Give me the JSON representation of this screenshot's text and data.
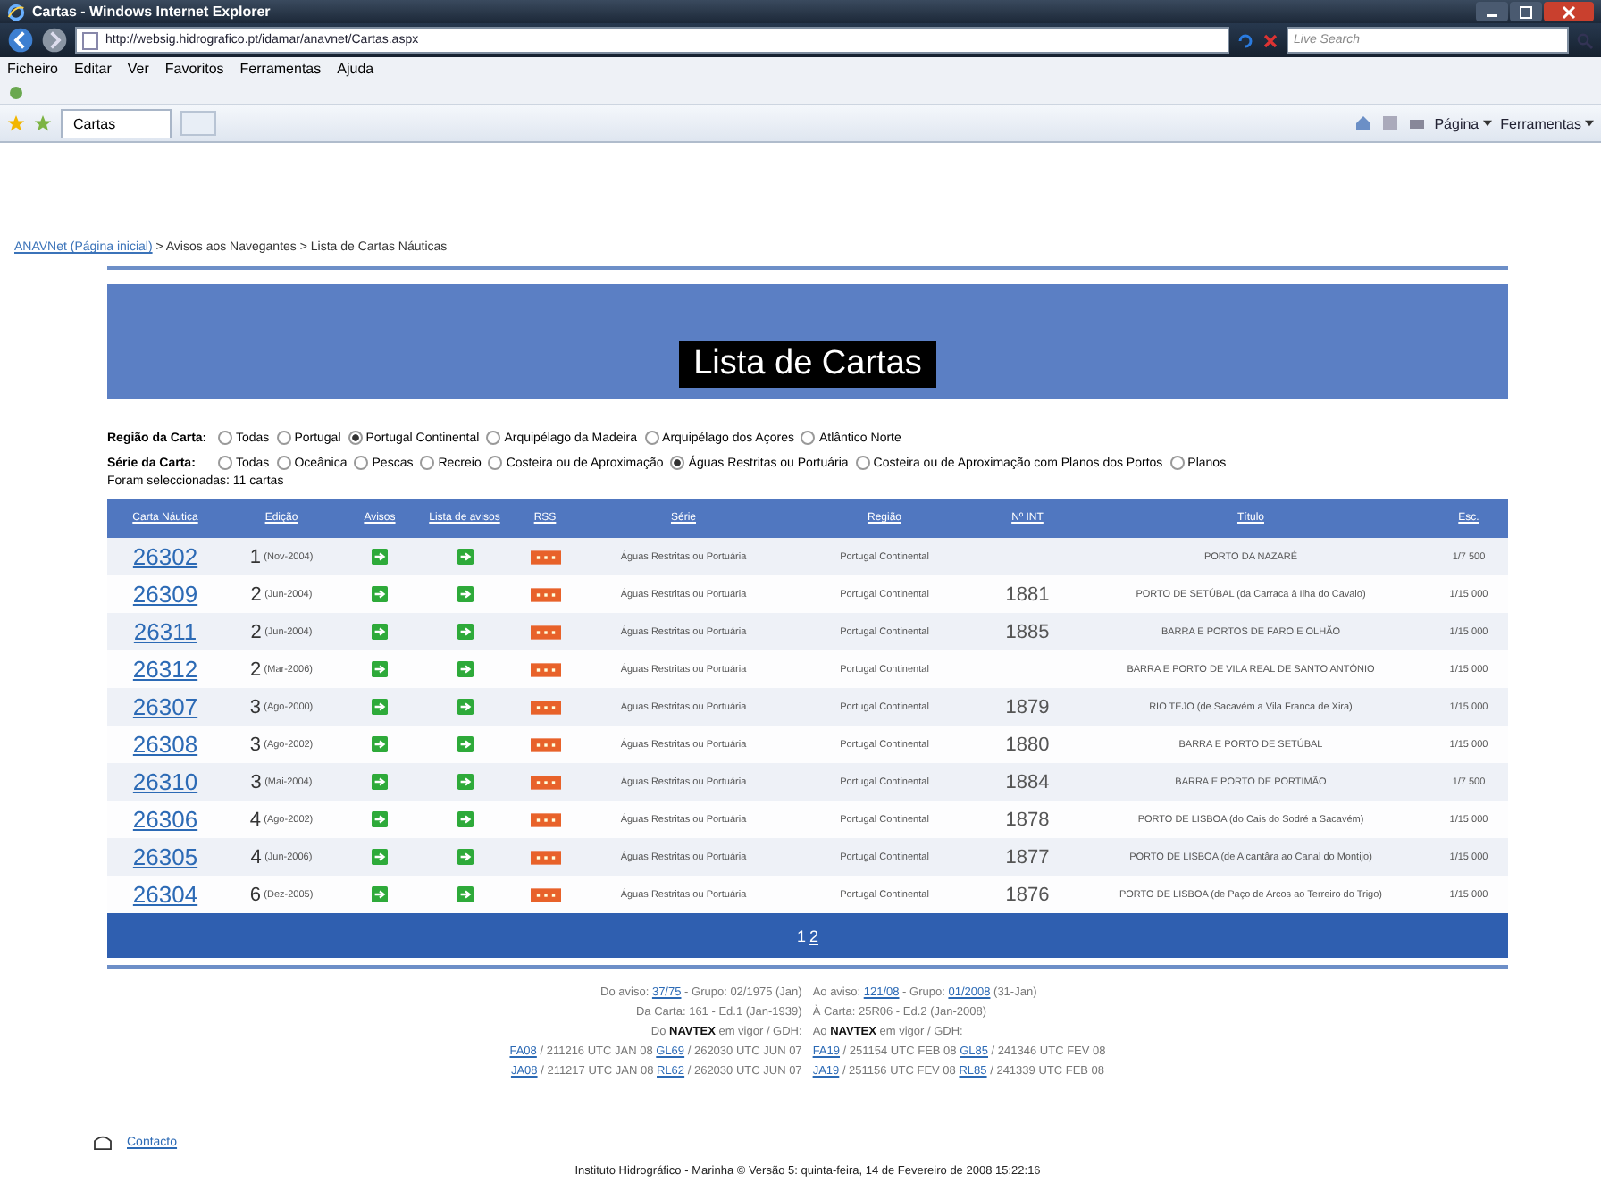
{
  "window": {
    "title": "Cartas - Windows Internet Explorer"
  },
  "address": {
    "url": "http://websig.hidrografico.pt/idamar/anavnet/Cartas.aspx",
    "search_placeholder": "Live Search"
  },
  "menu": [
    "Ficheiro",
    "Editar",
    "Ver",
    "Favoritos",
    "Ferramentas",
    "Ajuda"
  ],
  "tab": {
    "label": "Cartas"
  },
  "toolbar": [
    "Página",
    "Ferramentas"
  ],
  "breadcrumb": {
    "link": "ANAVNet (Página inicial)",
    "rest": " > Avisos aos Navegantes > Lista de Cartas Náuticas"
  },
  "heading": "Lista de Cartas",
  "filters": [
    {
      "label": "Região da Carta:",
      "options": [
        {
          "label": "Todas",
          "selected": false
        },
        {
          "label": "Portugal",
          "selected": false
        },
        {
          "label": "Portugal Continental",
          "selected": true
        },
        {
          "label": "Arquipélago da Madeira",
          "selected": false
        },
        {
          "label": "Arquipélago dos Açores",
          "selected": false
        },
        {
          "label": "Atlântico Norte",
          "selected": false
        }
      ]
    },
    {
      "label": "Série da Carta:",
      "options": [
        {
          "label": "Todas",
          "selected": false
        },
        {
          "label": "Oceânica",
          "selected": false
        },
        {
          "label": "Pescas",
          "selected": false
        },
        {
          "label": "Recreio",
          "selected": false
        },
        {
          "label": "Costeira ou de Aproximação",
          "selected": false
        },
        {
          "label": "Águas Restritas ou Portuária",
          "selected": true
        },
        {
          "label": "Costeira ou de Aproximação com Planos dos Portos",
          "selected": false
        },
        {
          "label": "Planos",
          "selected": false
        }
      ]
    }
  ],
  "result_count": "Foram seleccionadas: 11 cartas",
  "table": {
    "columns": [
      "Carta Náutica",
      "Edição",
      "Avisos",
      "Lista de avisos",
      "RSS",
      "Série",
      "Região",
      "Nº INT",
      "Título",
      "Esc."
    ],
    "rows": [
      {
        "carta": "26302",
        "edicao": "1",
        "data": "(Nov-2004)",
        "serie": "Águas Restritas ou Portuária",
        "regiao": "Portugal Continental",
        "nint": "",
        "titulo": "PORTO DA NAZARÉ",
        "esc": "1/7 500"
      },
      {
        "carta": "26309",
        "edicao": "2",
        "data": "(Jun-2004)",
        "serie": "Águas Restritas ou Portuária",
        "regiao": "Portugal Continental",
        "nint": "1881",
        "titulo": "PORTO DE SETÚBAL (da Carraca à Ilha do Cavalo)",
        "esc": "1/15 000"
      },
      {
        "carta": "26311",
        "edicao": "2",
        "data": "(Jun-2004)",
        "serie": "Águas Restritas ou Portuária",
        "regiao": "Portugal Continental",
        "nint": "1885",
        "titulo": "BARRA E PORTOS DE FARO E OLHÃO",
        "esc": "1/15 000"
      },
      {
        "carta": "26312",
        "edicao": "2",
        "data": "(Mar-2006)",
        "serie": "Águas Restritas ou Portuária",
        "regiao": "Portugal Continental",
        "nint": "",
        "titulo": "BARRA E PORTO DE VILA REAL DE SANTO ANTÓNIO",
        "esc": "1/15 000"
      },
      {
        "carta": "26307",
        "edicao": "3",
        "data": "(Ago-2000)",
        "serie": "Águas Restritas ou Portuária",
        "regiao": "Portugal Continental",
        "nint": "1879",
        "titulo": "RIO TEJO (de Sacavém a Vila Franca de Xira)",
        "esc": "1/15 000"
      },
      {
        "carta": "26308",
        "edicao": "3",
        "data": "(Ago-2002)",
        "serie": "Águas Restritas ou Portuária",
        "regiao": "Portugal Continental",
        "nint": "1880",
        "titulo": "BARRA E PORTO DE SETÚBAL",
        "esc": "1/15 000"
      },
      {
        "carta": "26310",
        "edicao": "3",
        "data": "(Mai-2004)",
        "serie": "Águas Restritas ou Portuária",
        "regiao": "Portugal Continental",
        "nint": "1884",
        "titulo": "BARRA E PORTO DE PORTIMÃO",
        "esc": "1/7 500"
      },
      {
        "carta": "26306",
        "edicao": "4",
        "data": "(Ago-2002)",
        "serie": "Águas Restritas ou Portuária",
        "regiao": "Portugal Continental",
        "nint": "1878",
        "titulo": "PORTO DE LISBOA (do Cais do Sodré a Sacavém)",
        "esc": "1/15 000"
      },
      {
        "carta": "26305",
        "edicao": "4",
        "data": "(Jun-2006)",
        "serie": "Águas Restritas ou Portuária",
        "regiao": "Portugal Continental",
        "nint": "1877",
        "titulo": "PORTO DE LISBOA (de Alcantâra ao Canal do Montijo)",
        "esc": "1/15 000"
      },
      {
        "carta": "26304",
        "edicao": "6",
        "data": "(Dez-2005)",
        "serie": "Águas Restritas ou Portuária",
        "regiao": "Portugal Continental",
        "nint": "1876",
        "titulo": "PORTO DE LISBOA (de Paço de Arcos ao Terreiro do Trigo)",
        "esc": "1/15 000"
      }
    ],
    "pages": [
      {
        "label": "1",
        "selected": true
      },
      {
        "label": "2",
        "selected": false
      }
    ]
  },
  "footer": {
    "left": [
      [
        {
          "kind": "text",
          "text": "Do aviso: "
        },
        {
          "kind": "link",
          "text": "37/75"
        },
        {
          "kind": "text",
          "text": " - Grupo: 02/1975 (Jan)"
        }
      ],
      [
        {
          "kind": "text",
          "text": "Da Carta: 161 - Ed.1 (Jan-1939)"
        }
      ],
      [
        {
          "kind": "text",
          "text": "Do "
        },
        {
          "kind": "bold",
          "text": "NAVTEX"
        },
        {
          "kind": "text",
          "text": " em vigor / GDH:"
        }
      ],
      [
        {
          "kind": "link",
          "text": "FA08"
        },
        {
          "kind": "text",
          "text": " / 211216 UTC JAN 08 "
        },
        {
          "kind": "link",
          "text": "GL69"
        },
        {
          "kind": "text",
          "text": " / 262030 UTC JUN 07"
        }
      ],
      [
        {
          "kind": "link",
          "text": "JA08"
        },
        {
          "kind": "text",
          "text": " / 211217 UTC JAN 08 "
        },
        {
          "kind": "link",
          "text": "RL62"
        },
        {
          "kind": "text",
          "text": " / 262030 UTC JUN 07"
        }
      ]
    ],
    "right": [
      [
        {
          "kind": "text",
          "text": "Ao aviso: "
        },
        {
          "kind": "link",
          "text": "121/08"
        },
        {
          "kind": "text",
          "text": " - Grupo: "
        },
        {
          "kind": "link",
          "text": "01/2008"
        },
        {
          "kind": "text",
          "text": " (31-Jan)"
        }
      ],
      [
        {
          "kind": "text",
          "text": "À Carta: 25R06 - Ed.2 (Jan-2008)"
        }
      ],
      [
        {
          "kind": "text",
          "text": "Ao "
        },
        {
          "kind": "bold",
          "text": "NAVTEX"
        },
        {
          "kind": "text",
          "text": " em vigor / GDH:"
        }
      ],
      [
        {
          "kind": "link",
          "text": "FA19"
        },
        {
          "kind": "text",
          "text": " / 251154 UTC FEB 08 "
        },
        {
          "kind": "link",
          "text": "GL85"
        },
        {
          "kind": "text",
          "text": " / 241346 UTC FEV 08"
        }
      ],
      [
        {
          "kind": "link",
          "text": "JA19"
        },
        {
          "kind": "text",
          "text": " / 251156 UTC FEV 08 "
        },
        {
          "kind": "link",
          "text": "RL85"
        },
        {
          "kind": "text",
          "text": " / 241339 UTC FEB 08"
        }
      ]
    ],
    "contact": "Contacto",
    "copyright": "Instituto Hidrográfico - Marinha © Versão 5: quinta-feira, 14 de Fevereiro de 2008 15:22:16"
  }
}
